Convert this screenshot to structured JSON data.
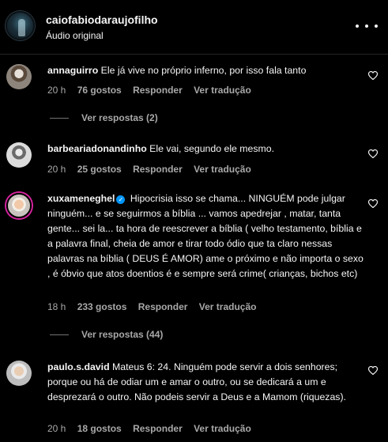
{
  "header": {
    "username": "caiofabiodaraujofilho",
    "subtitle": "Áudio original"
  },
  "labels": {
    "reply": "Responder",
    "translate": "Ver tradução"
  },
  "comments": [
    {
      "username": "annaguirro",
      "text": "Ele já vive no próprio inferno, por isso fala tanto",
      "time": "20 h",
      "likes": "76 gostos",
      "replies": "Ver respostas (2)"
    },
    {
      "username": "barbeariadonandinho",
      "text": "Ele vai, segundo ele mesmo.",
      "time": "20 h",
      "likes": "25 gostos",
      "replies": ""
    },
    {
      "username": "xuxameneghel",
      "verified": true,
      "text": "Hipocrisia isso se chama... NINGUÉM pode julgar ninguém... e se seguirmos a bíblia ... vamos apedrejar , matar, tanta gente... sei la... ta hora de reescrever a bíblia ( velho testamento, bíblia e a palavra final, cheia de amor e tirar todo ódio que ta claro nessas palavras na bíblia ( DEUS É AMOR) ame o próximo e não importa o sexo , é óbvio que atos doentios é e sempre será crime( crianças, bichos etc)",
      "time": "18 h",
      "likes": "233 gostos",
      "replies": "Ver respostas (44)"
    },
    {
      "username": "paulo.s.david",
      "text": "Mateus 6: 24. Ninguém pode servir a dois senhores; porque ou há de odiar um e amar o outro, ou se dedicará a um e desprezará o outro. Não podeis servir a Deus e a Mamom (riquezas).",
      "time": "20 h",
      "likes": "18 gostos",
      "replies": ""
    }
  ],
  "colors": {
    "background": "#000000",
    "text": "#f5f5f5",
    "secondary": "#a8a8a8",
    "verified": "#0095f6"
  }
}
